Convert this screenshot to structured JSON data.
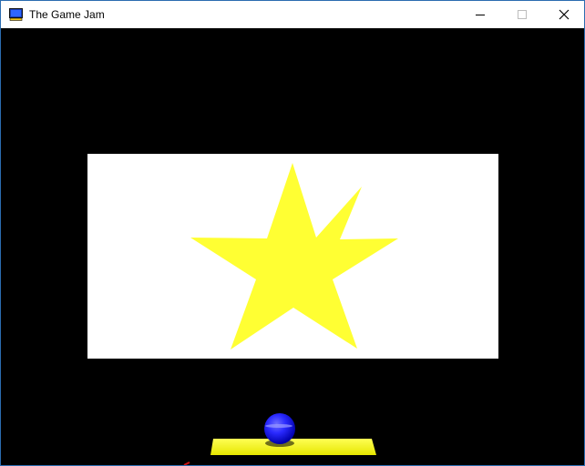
{
  "window": {
    "title": "The Game Jam"
  },
  "colors": {
    "background": "#000000",
    "card": "#ffffff",
    "star": "#ffff33",
    "paddle": "#ffff33",
    "ball": "#2a2aff"
  },
  "icons": {
    "app": "app-monitor-icon",
    "minimize": "minimize-icon",
    "maximize": "maximize-icon",
    "close": "close-icon"
  }
}
